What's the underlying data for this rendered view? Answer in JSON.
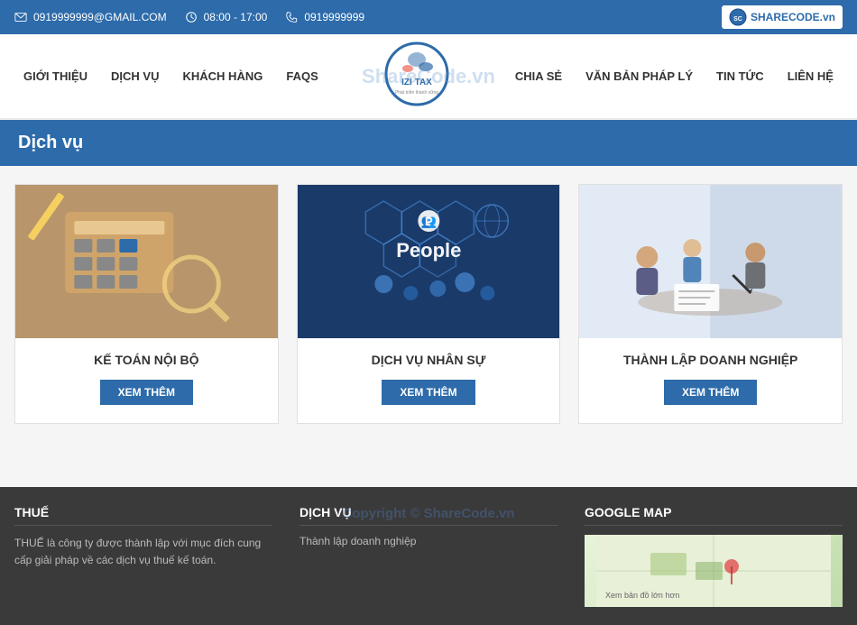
{
  "topbar": {
    "email": "0919999999@GMAIL.COM",
    "hours": "08:00 - 17:00",
    "phone": "0919999999",
    "brand": "SHARECODE.vn"
  },
  "navbar": {
    "left_items": [
      "GIỚI THIỆU",
      "DỊCH VỤ",
      "KHÁCH HÀNG",
      "FAQS"
    ],
    "right_items": [
      "CHIA SẺ",
      "VĂN BẢN PHÁP LÝ",
      "TIN TỨC",
      "LIÊN HỆ"
    ],
    "logo_name": "IZI TAX",
    "logo_tagline": "Phát triển thành vững",
    "watermark": "ShareCode.vn"
  },
  "section": {
    "title": "Dịch vụ"
  },
  "services": [
    {
      "id": "ke-toan",
      "title": "KẾ TOÁN NỘI BỘ",
      "btn_label": "XEM THÊM",
      "img_type": "accounting"
    },
    {
      "id": "nhan-su",
      "title": "Dịch vụ nhân sự",
      "btn_label": "XEM THÊM",
      "img_type": "people"
    },
    {
      "id": "thanh-lap",
      "title": "THÀNH LẬP DOANH NGHIỆP",
      "btn_label": "XEM THÊM",
      "img_type": "business"
    }
  ],
  "footer": {
    "about_title": "THUẾ",
    "about_text": "THUẾ là công ty được thành lập với mục đích cung cấp giải pháp về các dịch vụ thuế kế toán.",
    "services_title": "DỊCH VỤ",
    "services_links": [
      "Thành lập doanh nghiệp"
    ],
    "map_title": "GOOGLE MAP",
    "map_text": "Xem bản đồ lớn hơn"
  },
  "copyright": "Copyright © ShareCode.vn"
}
